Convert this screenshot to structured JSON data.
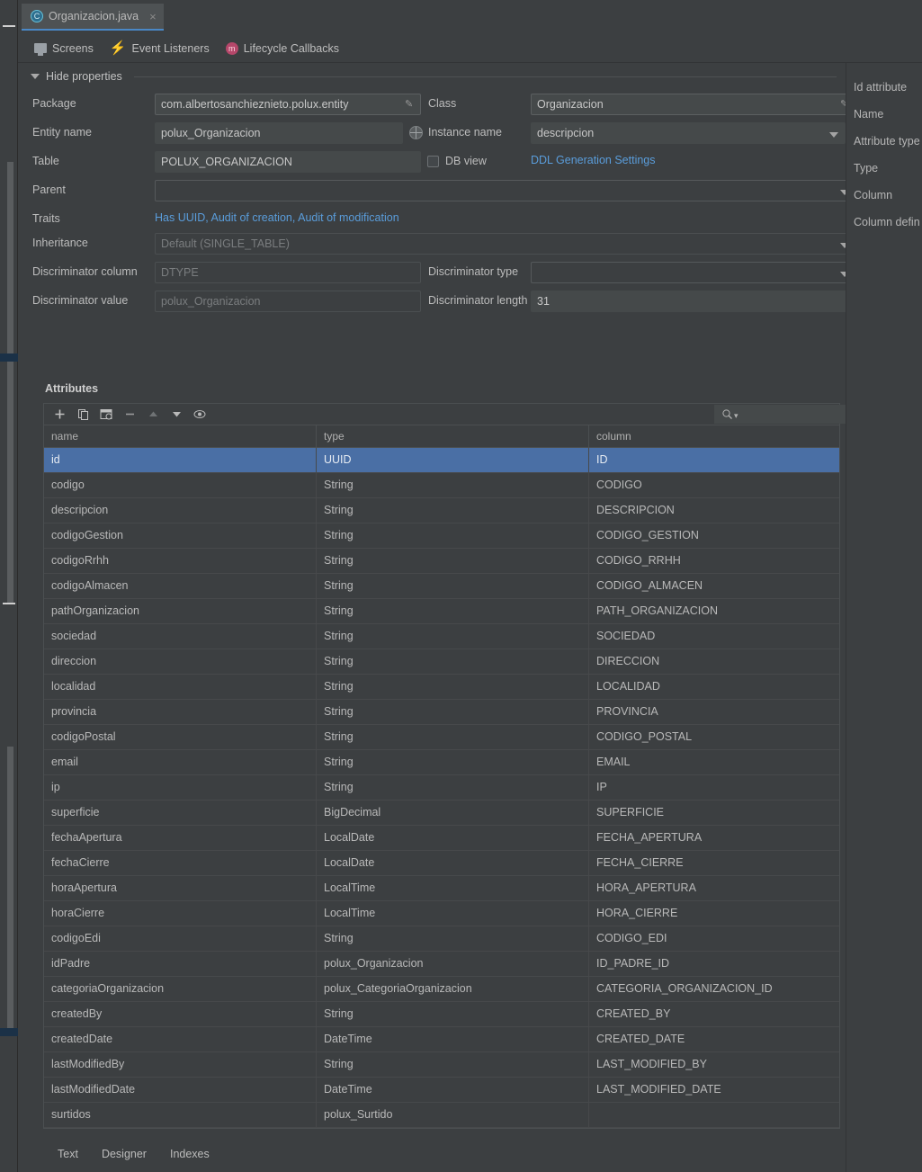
{
  "tab": {
    "title": "Organizacion.java",
    "icon": "java-class-icon",
    "close": "×"
  },
  "subtoolbar": {
    "items": [
      {
        "label": "Screens",
        "icon": "monitor-icon"
      },
      {
        "label": "Event Listeners",
        "icon": "lightning-bolt-icon"
      },
      {
        "label": "Lifecycle Callbacks",
        "icon": "method-m-icon"
      }
    ]
  },
  "properties": {
    "header": "Hide properties",
    "package": {
      "label": "Package",
      "value": "com.albertosanchieznieto.polux.entity"
    },
    "class": {
      "label": "Class",
      "value": "Organizacion"
    },
    "entity_name": {
      "label": "Entity name",
      "value": "polux_Organizacion"
    },
    "instance_name": {
      "label": "Instance name",
      "value": "descripcion"
    },
    "table": {
      "label": "Table",
      "value": "POLUX_ORGANIZACION"
    },
    "db_view": {
      "label": "DB view",
      "checked": false
    },
    "ddl_link": "DDL Generation Settings",
    "parent": {
      "label": "Parent",
      "value": ""
    },
    "traits": {
      "label": "Traits",
      "value": "Has UUID, Audit of creation, Audit of modification"
    },
    "inheritance": {
      "label": "Inheritance",
      "value": "Default (SINGLE_TABLE)"
    },
    "discriminator_column": {
      "label": "Discriminator column",
      "value": "DTYPE"
    },
    "discriminator_type": {
      "label": "Discriminator type",
      "value": ""
    },
    "discriminator_value": {
      "label": "Discriminator value",
      "value": "polux_Organizacion"
    },
    "discriminator_length": {
      "label": "Discriminator length",
      "value": "31"
    }
  },
  "attributes": {
    "title": "Attributes",
    "toolbar": [
      {
        "name": "add-button",
        "icon": "plus-icon"
      },
      {
        "name": "copy-button",
        "icon": "copy-icon"
      },
      {
        "name": "generate-button",
        "icon": "generate-icon"
      },
      {
        "name": "remove-button",
        "icon": "minus-icon"
      },
      {
        "name": "move-up-button",
        "icon": "arrow-up-icon"
      },
      {
        "name": "move-down-button",
        "icon": "arrow-down-icon"
      },
      {
        "name": "preview-button",
        "icon": "eye-icon"
      }
    ],
    "search_placeholder": "",
    "columns": [
      "name",
      "type",
      "column"
    ],
    "selected_row": 0,
    "rows": [
      [
        "id",
        "UUID",
        "ID"
      ],
      [
        "codigo",
        "String",
        "CODIGO"
      ],
      [
        "descripcion",
        "String",
        "DESCRIPCION"
      ],
      [
        "codigoGestion",
        "String",
        "CODIGO_GESTION"
      ],
      [
        "codigoRrhh",
        "String",
        "CODIGO_RRHH"
      ],
      [
        "codigoAlmacen",
        "String",
        "CODIGO_ALMACEN"
      ],
      [
        "pathOrganizacion",
        "String",
        "PATH_ORGANIZACION"
      ],
      [
        "sociedad",
        "String",
        "SOCIEDAD"
      ],
      [
        "direccion",
        "String",
        "DIRECCION"
      ],
      [
        "localidad",
        "String",
        "LOCALIDAD"
      ],
      [
        "provincia",
        "String",
        "PROVINCIA"
      ],
      [
        "codigoPostal",
        "String",
        "CODIGO_POSTAL"
      ],
      [
        "email",
        "String",
        "EMAIL"
      ],
      [
        "ip",
        "String",
        "IP"
      ],
      [
        "superficie",
        "BigDecimal",
        "SUPERFICIE"
      ],
      [
        "fechaApertura",
        "LocalDate",
        "FECHA_APERTURA"
      ],
      [
        "fechaCierre",
        "LocalDate",
        "FECHA_CIERRE"
      ],
      [
        "horaApertura",
        "LocalTime",
        "HORA_APERTURA"
      ],
      [
        "horaCierre",
        "LocalTime",
        "HORA_CIERRE"
      ],
      [
        "codigoEdi",
        "String",
        "CODIGO_EDI"
      ],
      [
        "idPadre",
        "polux_Organizacion",
        "ID_PADRE_ID"
      ],
      [
        "categoriaOrganizacion",
        "polux_CategoriaOrganizacion",
        "CATEGORIA_ORGANIZACION_ID"
      ],
      [
        "createdBy",
        "String",
        "CREATED_BY"
      ],
      [
        "createdDate",
        "DateTime",
        "CREATED_DATE"
      ],
      [
        "lastModifiedBy",
        "String",
        "LAST_MODIFIED_BY"
      ],
      [
        "lastModifiedDate",
        "DateTime",
        "LAST_MODIFIED_DATE"
      ],
      [
        "surtidos",
        "polux_Surtido",
        ""
      ]
    ]
  },
  "right_panel": {
    "items": [
      "Id attribute",
      "Name",
      "Attribute type",
      "Type",
      "Column",
      "Column defin"
    ]
  },
  "bottom_tabs": [
    {
      "label": "Text"
    },
    {
      "label": "Designer"
    },
    {
      "label": "Indexes"
    }
  ],
  "colors": {
    "background": "#3c3f41",
    "selection": "#4a6fa5",
    "link": "#5a9ddb",
    "tab_underline": "#4a88c7"
  }
}
